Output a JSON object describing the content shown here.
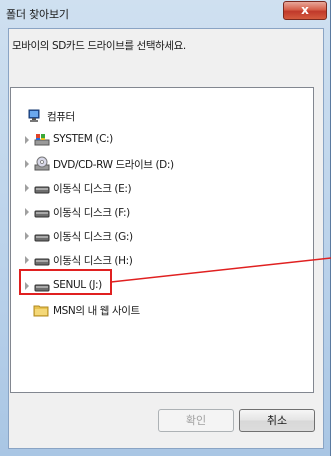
{
  "window": {
    "title": "폴더 찾아보기",
    "close_label": "x"
  },
  "instruction": "모바이의 SD카드 드라이브를 선택하세요.",
  "tree": {
    "items": [
      {
        "label": "컴퓨터",
        "icon": "computer-icon"
      },
      {
        "label": "SYSTEM (C:)",
        "icon": "system-drive-icon"
      },
      {
        "label": "DVD/CD-RW 드라이브 (D:)",
        "icon": "dvd-drive-icon"
      },
      {
        "label": "이동식 디스크 (E:)",
        "icon": "removable-disk-icon"
      },
      {
        "label": "이동식 디스크 (F:)",
        "icon": "removable-disk-icon"
      },
      {
        "label": "이동식 디스크 (G:)",
        "icon": "removable-disk-icon"
      },
      {
        "label": "이동식 디스크 (H:)",
        "icon": "removable-disk-icon"
      },
      {
        "label": "SENUL (J:)",
        "icon": "removable-disk-icon"
      },
      {
        "label": "MSN의 내 웹 사이트",
        "icon": "folder-icon"
      }
    ]
  },
  "buttons": {
    "ok_label": "확인",
    "cancel_label": "취소"
  },
  "colors": {
    "highlight": "#e02020",
    "title_bar": "#b9d1ea",
    "close_button": "#c0392b"
  }
}
